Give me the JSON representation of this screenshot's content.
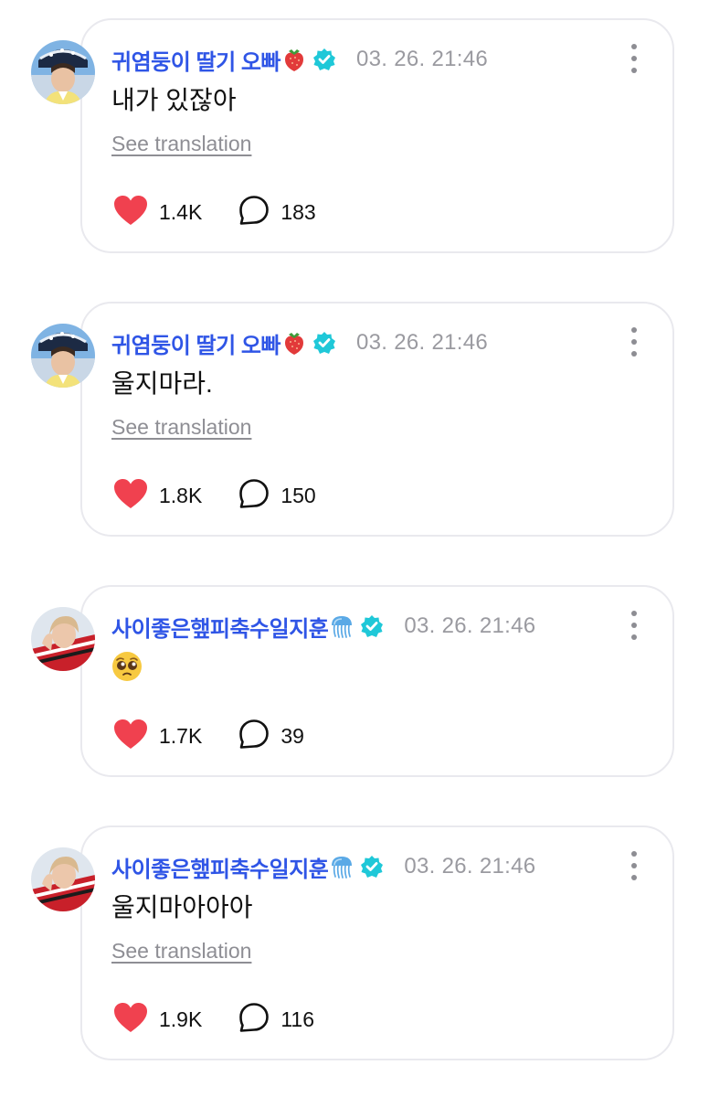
{
  "colors": {
    "accent": "#2f55e6",
    "verified": "#1fc8d8",
    "heart": "#f0414f",
    "muted": "#9a9aa0"
  },
  "posts": [
    {
      "author": "귀염둥이 딸기 오빠",
      "author_emoji": "strawberry-icon",
      "date": "03. 26. 21:46",
      "text": "내가 있잖아",
      "translate_label": "See translation",
      "likes": "1.4K",
      "comments": "183"
    },
    {
      "author": "귀염둥이 딸기 오빠",
      "author_emoji": "strawberry-icon",
      "date": "03. 26. 21:46",
      "text": "울지마라.",
      "translate_label": "See translation",
      "likes": "1.8K",
      "comments": "150"
    },
    {
      "author": "사이좋은햎피축수일지훈",
      "author_emoji": "jellyfish-icon",
      "date": "03. 26. 21:46",
      "text": "🥺",
      "likes": "1.7K",
      "comments": "39"
    },
    {
      "author": "사이좋은햎피축수일지훈",
      "author_emoji": "jellyfish-icon",
      "date": "03. 26. 21:46",
      "text": "울지마아아아",
      "translate_label": "See translation",
      "likes": "1.9K",
      "comments": "116"
    }
  ]
}
